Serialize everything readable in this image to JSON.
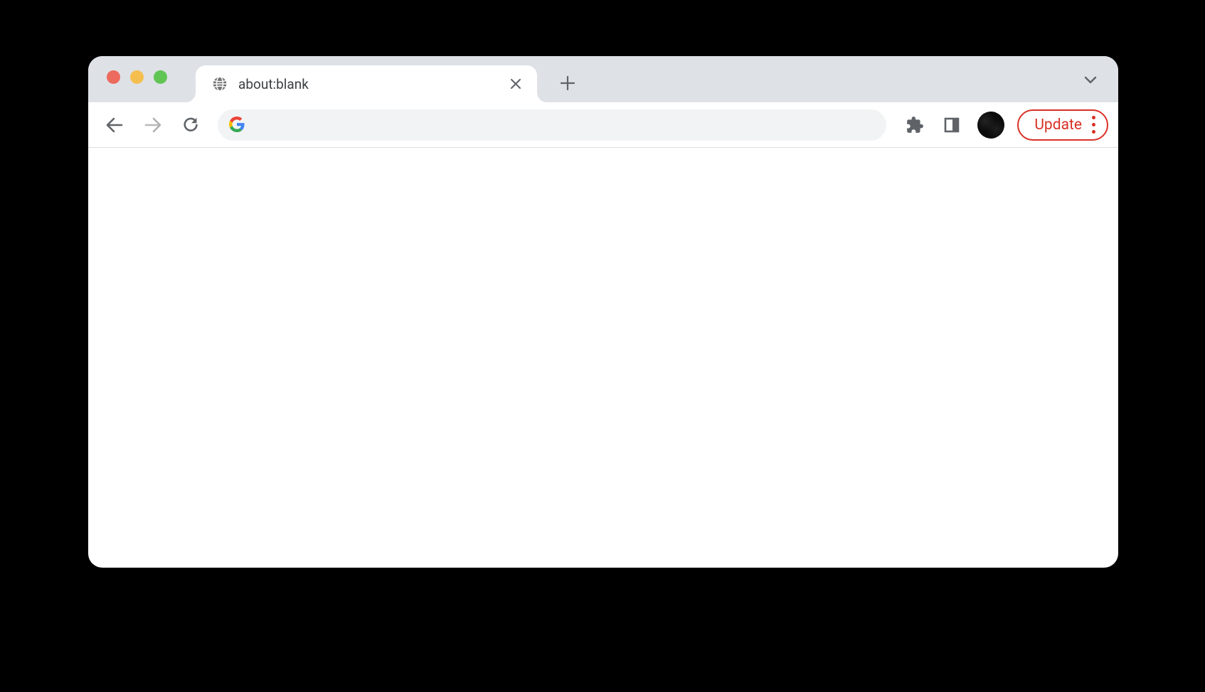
{
  "tab": {
    "title": "about:blank"
  },
  "address_bar": {
    "value": ""
  },
  "update_button": {
    "label": "Update"
  },
  "colors": {
    "accent_red": "#d93025",
    "tab_strip_bg": "#dee1e6",
    "address_bg": "#f1f3f4"
  }
}
